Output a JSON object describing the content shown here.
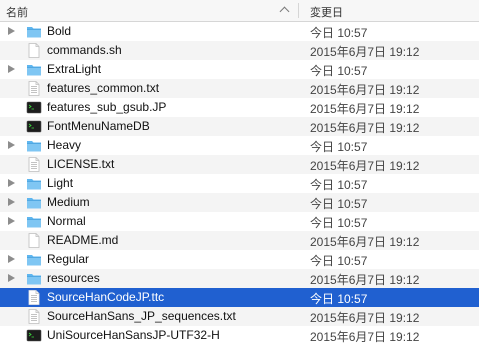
{
  "header": {
    "name_label": "名前",
    "date_label": "変更日"
  },
  "files": [
    {
      "name": "Bold",
      "date": "今日 10:57",
      "kind": "folder",
      "icon": "folder-icon"
    },
    {
      "name": "commands.sh",
      "date": "2015年6月7日 19:12",
      "kind": "document",
      "icon": "document-icon"
    },
    {
      "name": "ExtraLight",
      "date": "今日 10:57",
      "kind": "folder",
      "icon": "folder-icon"
    },
    {
      "name": "features_common.txt",
      "date": "2015年6月7日 19:12",
      "kind": "text",
      "icon": "text-file-icon"
    },
    {
      "name": "features_sub_gsub.JP",
      "date": "2015年6月7日 19:12",
      "kind": "exec",
      "icon": "terminal-executable-icon"
    },
    {
      "name": "FontMenuNameDB",
      "date": "2015年6月7日 19:12",
      "kind": "exec",
      "icon": "terminal-executable-icon"
    },
    {
      "name": "Heavy",
      "date": "今日 10:57",
      "kind": "folder",
      "icon": "folder-icon"
    },
    {
      "name": "LICENSE.txt",
      "date": "2015年6月7日 19:12",
      "kind": "text",
      "icon": "text-file-icon"
    },
    {
      "name": "Light",
      "date": "今日 10:57",
      "kind": "folder",
      "icon": "folder-icon"
    },
    {
      "name": "Medium",
      "date": "今日 10:57",
      "kind": "folder",
      "icon": "folder-icon"
    },
    {
      "name": "Normal",
      "date": "今日 10:57",
      "kind": "folder",
      "icon": "folder-icon"
    },
    {
      "name": "README.md",
      "date": "2015年6月7日 19:12",
      "kind": "document",
      "icon": "document-icon"
    },
    {
      "name": "Regular",
      "date": "今日 10:57",
      "kind": "folder",
      "icon": "folder-icon"
    },
    {
      "name": "resources",
      "date": "2015年6月7日 19:12",
      "kind": "folder",
      "icon": "folder-icon"
    },
    {
      "name": "SourceHanCodeJP.ttc",
      "date": "今日 10:57",
      "kind": "text",
      "icon": "font-file-icon",
      "selected": true
    },
    {
      "name": "SourceHanSans_JP_sequences.txt",
      "date": "2015年6月7日 19:12",
      "kind": "text",
      "icon": "text-file-icon"
    },
    {
      "name": "UniSourceHanSansJP-UTF32-H",
      "date": "2015年6月7日 19:12",
      "kind": "exec",
      "icon": "terminal-executable-icon"
    }
  ],
  "colors": {
    "selection": "#2060d0",
    "folder": "#5fb6ef",
    "folder_tab": "#7fc6f3"
  }
}
